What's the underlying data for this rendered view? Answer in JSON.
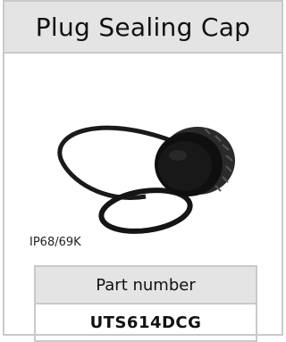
{
  "header": {
    "title": "Plug Sealing Cap"
  },
  "product": {
    "rating": "IP68/69K"
  },
  "spec_table": {
    "header": "Part number",
    "value": "UTS614DCG"
  },
  "colors": {
    "panel_gray": "#e4e4e4",
    "border": "#c9c9c9",
    "cap_black": "#111111"
  }
}
